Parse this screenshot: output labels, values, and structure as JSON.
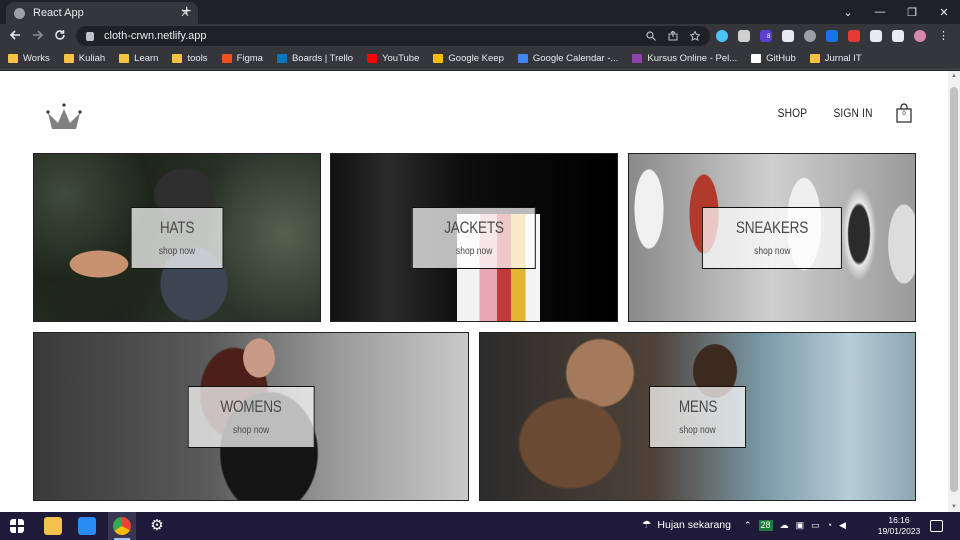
{
  "browser": {
    "tab_title": "React App",
    "tab_close": "✕",
    "new_tab": "+",
    "url": "cloth-crwn.netlify.app",
    "window_controls": [
      "⌄",
      "—",
      "❐",
      "✕"
    ],
    "ext_badge": "8"
  },
  "bookmarks": [
    {
      "label": "Works",
      "icon": "folder-icon",
      "color": "#f6c244"
    },
    {
      "label": "Kuliah",
      "icon": "folder-icon",
      "color": "#f6c244"
    },
    {
      "label": "Learn",
      "icon": "folder-icon",
      "color": "#f6c244"
    },
    {
      "label": "tools",
      "icon": "folder-icon",
      "color": "#f6c244"
    },
    {
      "label": "Figma",
      "icon": "figma-icon",
      "color": "#f24e1e"
    },
    {
      "label": "Boards | Trello",
      "icon": "trello-icon",
      "color": "#0079bf"
    },
    {
      "label": "YouTube",
      "icon": "youtube-icon",
      "color": "#ff0000"
    },
    {
      "label": "Google Keep",
      "icon": "keep-icon",
      "color": "#fbbc04"
    },
    {
      "label": "Google Calendar -...",
      "icon": "calendar-icon",
      "color": "#4285f4"
    },
    {
      "label": "Kursus Online - Pel...",
      "icon": "course-icon",
      "color": "#8e44ad"
    },
    {
      "label": "GitHub",
      "icon": "github-icon",
      "color": "#ffffff"
    },
    {
      "label": "Jurnal IT",
      "icon": "folder-icon",
      "color": "#f6c244"
    }
  ],
  "header": {
    "shop": "SHOP",
    "sign_in": "SIGN IN",
    "cart_count": "0"
  },
  "directory": [
    {
      "id": "hats",
      "title": "HATS",
      "subtitle": "shop now"
    },
    {
      "id": "jackets",
      "title": "JACKETS",
      "subtitle": "shop now"
    },
    {
      "id": "sneakers",
      "title": "SNEAKERS",
      "subtitle": "shop now"
    },
    {
      "id": "womens",
      "title": "WOMENS",
      "subtitle": "shop now"
    },
    {
      "id": "mens",
      "title": "MENS",
      "subtitle": "shop now"
    }
  ],
  "taskbar": {
    "weather": "Hujan sekarang",
    "time": "16:16",
    "date": "19/01/2023",
    "tray_badge": "28"
  }
}
